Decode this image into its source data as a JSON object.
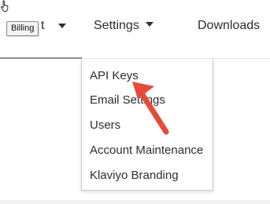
{
  "nav": {
    "account_hidden_text": "t",
    "tooltip": "Billing",
    "settings_label": "Settings",
    "downloads_label": "Downloads"
  },
  "settings_menu": {
    "items": [
      "API Keys",
      "Email Settings",
      "Users",
      "Account Maintenance",
      "Klaviyo Branding"
    ]
  },
  "annotation": {
    "arrow_color": "#e84a3a",
    "points_to": "API Keys"
  },
  "icons": {
    "cursor": "hand-pointer-icon",
    "caret": "caret-down-icon"
  }
}
